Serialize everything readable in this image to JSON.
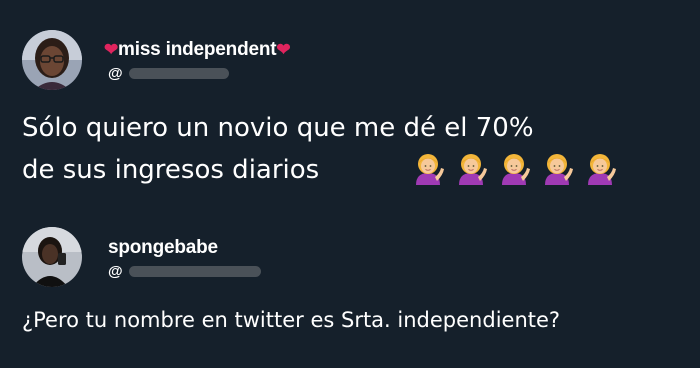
{
  "tweet1": {
    "display_name": "miss independent",
    "handle_prefix": "@",
    "text_line1": "Sólo quiero un novio que me dé el 70%",
    "text_line2": "de sus ingresos diarios",
    "emoji_icons": [
      "woman-tipping-hand-icon",
      "woman-tipping-hand-icon",
      "woman-tipping-hand-icon",
      "woman-tipping-hand-icon",
      "woman-tipping-hand-icon"
    ]
  },
  "tweet2": {
    "display_name": "spongebabe",
    "handle_prefix": "@",
    "text": "¿Pero tu nombre en twitter es Srta. independiente?"
  },
  "colors": {
    "background": "#15202b",
    "text": "#ffffff",
    "heart": "#e0245e"
  }
}
